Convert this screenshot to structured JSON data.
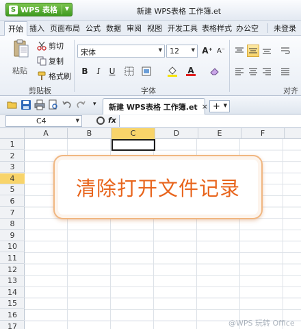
{
  "app": {
    "menu_label": "WPS 表格",
    "window_title": "新建 WPS表格 工作簿.et"
  },
  "ribbon_tabs": [
    "开始",
    "插入",
    "页面布局",
    "公式",
    "数据",
    "审阅",
    "视图",
    "开发工具",
    "表格样式",
    "办公空",
    "未登录"
  ],
  "clipboard": {
    "paste_label": "粘贴",
    "cut_label": "剪切",
    "copy_label": "复制",
    "format_painter_label": "格式刷",
    "group_label": "剪贴板"
  },
  "font": {
    "name": "宋体",
    "size": "12",
    "group_label": "字体",
    "bold": "B",
    "italic": "I",
    "underline": "U",
    "grow": "A⁺",
    "shrink": "A⁻"
  },
  "alignment": {
    "group_label": "对齐"
  },
  "document_tab": {
    "title": "新建 WPS表格 工作簿.et",
    "close": "×",
    "new_tab": "+"
  },
  "formula_bar": {
    "cell_ref": "C4",
    "fx": "fx",
    "value": ""
  },
  "columns": [
    "A",
    "B",
    "C",
    "D",
    "E",
    "F"
  ],
  "rows": [
    "1",
    "2",
    "3",
    "4",
    "5",
    "6",
    "7",
    "8",
    "9",
    "10",
    "11",
    "12",
    "13",
    "14",
    "15",
    "16",
    "17"
  ],
  "callout": {
    "text": "清除打开文件记录"
  },
  "watermark": "@WPS 玩转 Office",
  "colors": {
    "accent": "#e8651d",
    "selection": "#f8d46a",
    "app_green": "#3f9a20"
  }
}
